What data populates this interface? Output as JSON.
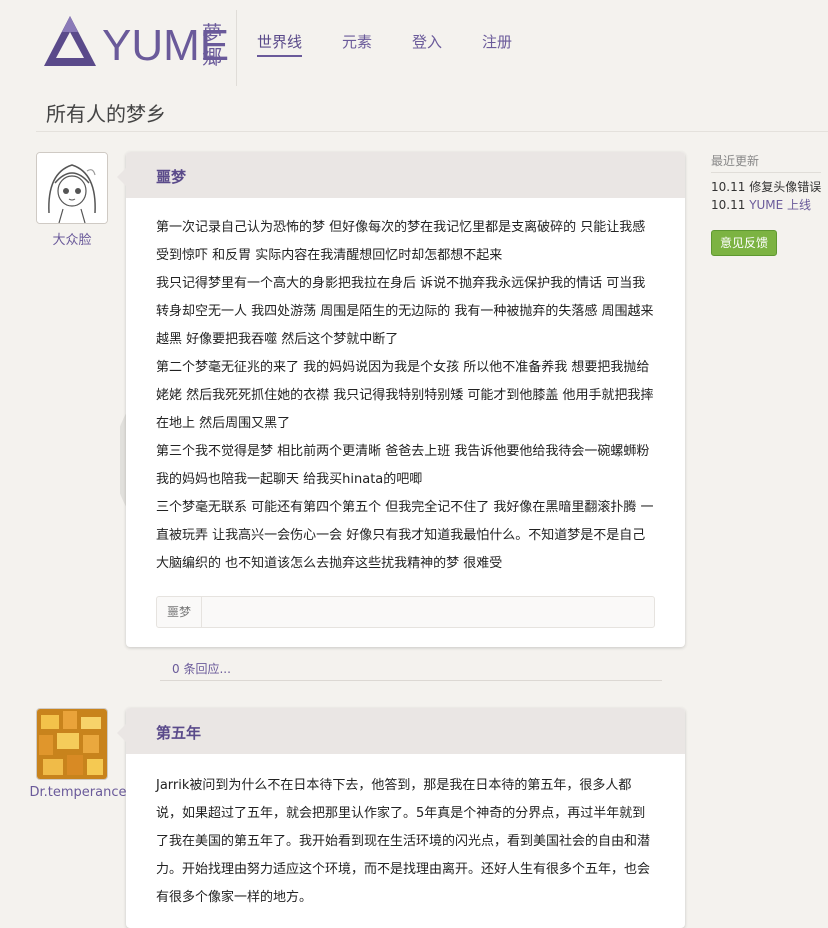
{
  "brand": {
    "name": "YUME",
    "kanji_top": "夢",
    "kanji_bottom": "郷"
  },
  "nav": [
    {
      "label": "世界线",
      "active": true
    },
    {
      "label": "元素",
      "active": false
    },
    {
      "label": "登入",
      "active": false
    },
    {
      "label": "注册",
      "active": false
    }
  ],
  "page_title": "所有人的梦乡",
  "posts": [
    {
      "author": "大众脸",
      "title": "噩梦",
      "paragraphs": [
        "第一次记录自己认为恐怖的梦 但好像每次的梦在我记忆里都是支离破碎的 只能让我感受到惊吓 和反胃 实际内容在我清醒想回忆时却怎都想不起来",
        "我只记得梦里有一个高大的身影把我拉在身后 诉说不抛弃我永远保护我的情话 可当我转身却空无一人 我四处游荡 周围是陌生的无边际的 我有一种被抛弃的失落感 周围越来越黑 好像要把我吞噬 然后这个梦就中断了",
        "第二个梦毫无征兆的来了 我的妈妈说因为我是个女孩 所以他不准备养我 想要把我抛给姥姥 然后我死死抓住她的衣襟 我只记得我特别特别矮 可能才到他膝盖 他用手就把我摔在地上 然后周围又黑了",
        "第三个我不觉得是梦 相比前两个更清晰 爸爸去上班 我告诉他要他给我待会一碗螺蛳粉 我的妈妈也陪我一起聊天 给我买hinata的吧唧",
        "三个梦毫无联系 可能还有第四个第五个 但我完全记不住了 我好像在黑暗里翻滚扑腾 一直被玩弄 让我高兴一会伤心一会 好像只有我才知道我最怕什么。不知道梦是不是自己大脑编织的 也不知道该怎么去抛弃这些扰我精神的梦 很难受"
      ],
      "tag": "噩梦",
      "replies": "0 条回应..."
    },
    {
      "author": "Dr.temperance",
      "title": "第五年",
      "paragraphs": [
        "Jarrik被问到为什么不在日本待下去，他答到，那是我在日本待的第五年，很多人都说，如果超过了五年，就会把那里认作家了。5年真是个神奇的分界点，再过半年就到了我在美国的第五年了。我开始看到现在生活环境的闪光点，看到美国社会的自由和潜力。开始找理由努力适应这个环境，而不是找理由离开。还好人生有很多个五年，也会有很多个像家一样的地方。"
      ]
    }
  ],
  "sidebar": {
    "label": "最近更新",
    "updates": [
      {
        "date": "10.11",
        "text": "修复头像错误",
        "link": ""
      },
      {
        "date": "10.11",
        "text": "",
        "link": "YUME 上线"
      }
    ],
    "feedback_label": "意见反馈"
  },
  "colors": {
    "accent": "#6a5a9a",
    "feedback": "#7cb342",
    "card_head": "#eae6e4",
    "background": "#f4f2ee"
  }
}
